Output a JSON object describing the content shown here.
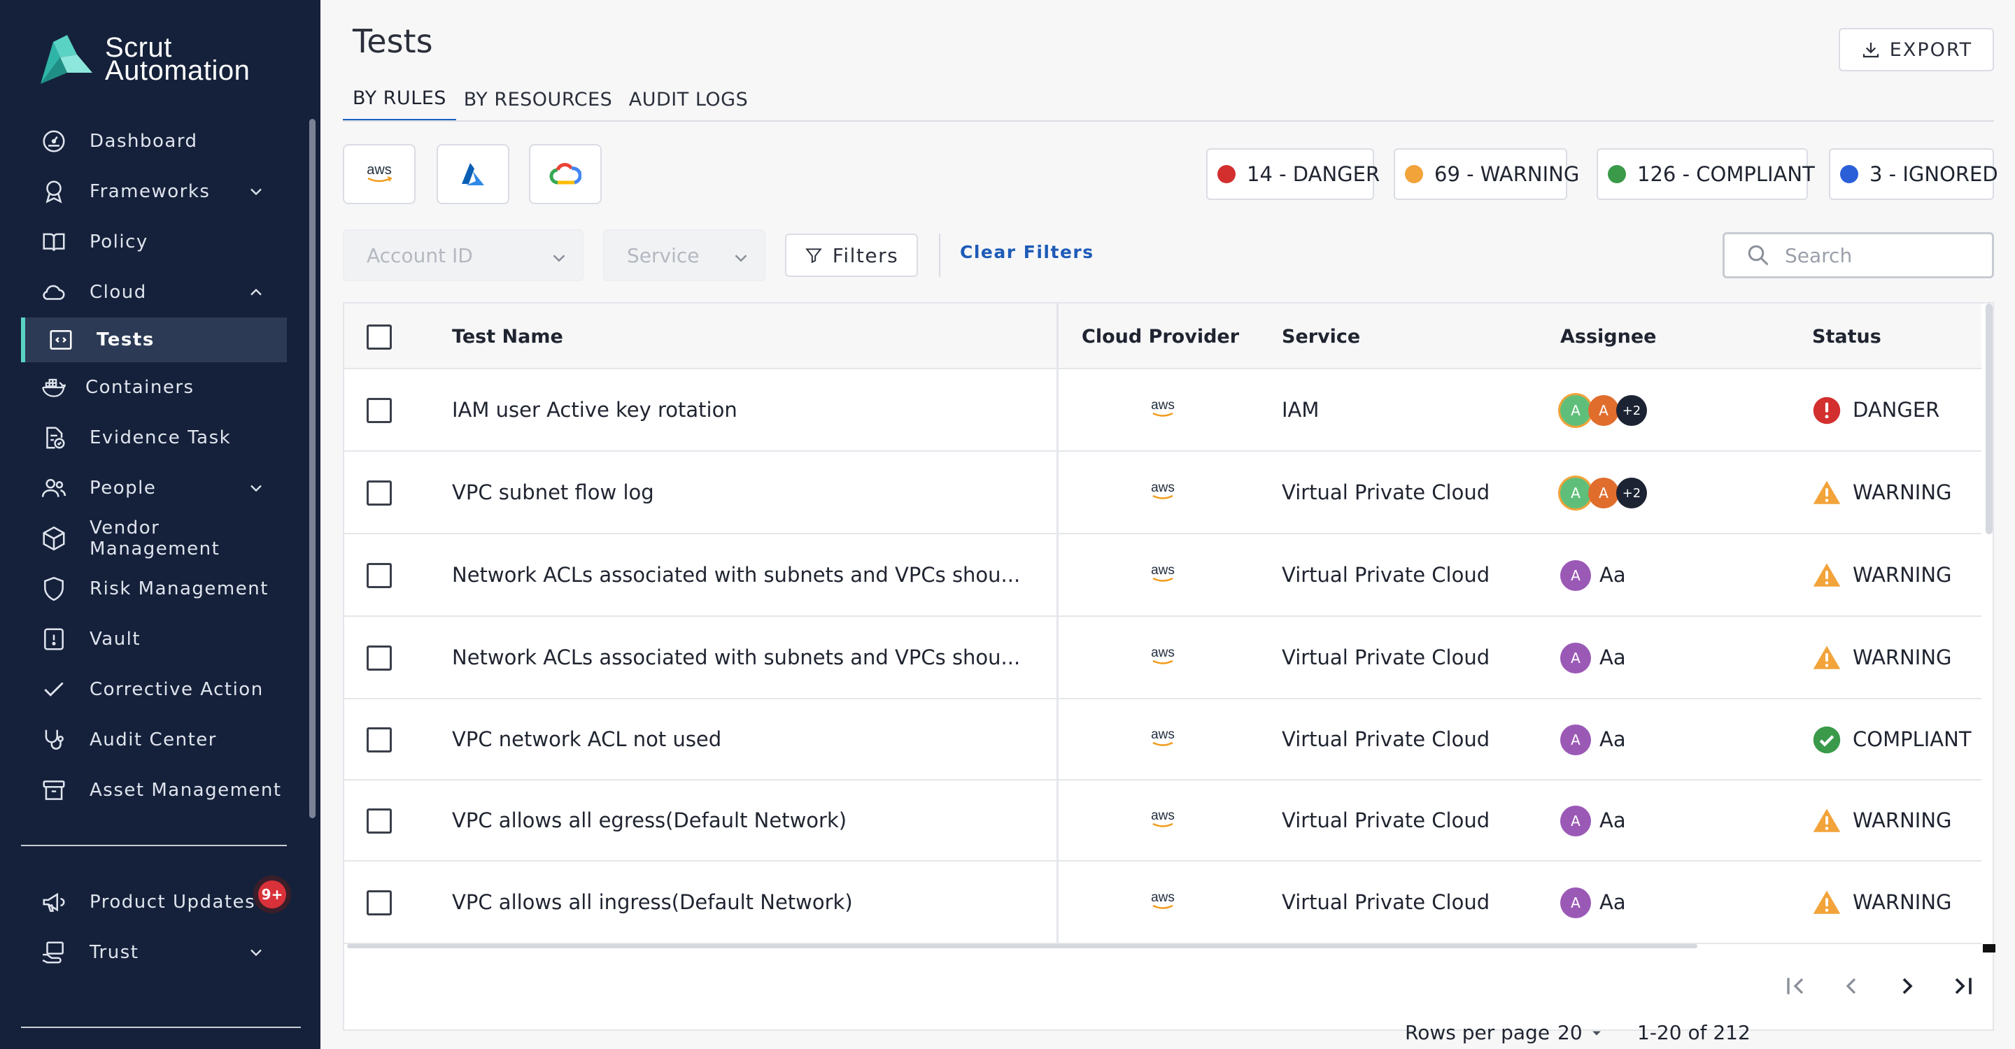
{
  "brand": {
    "line1": "Scrut",
    "line2": "Automation"
  },
  "sidebar": {
    "items": [
      {
        "label": "Dashboard",
        "icon": "dashboard-gauge-icon"
      },
      {
        "label": "Frameworks",
        "icon": "award-icon",
        "expand": "chevron-down"
      },
      {
        "label": "Policy",
        "icon": "book-icon"
      },
      {
        "label": "Cloud",
        "icon": "cloud-icon",
        "expand": "chevron-up"
      },
      {
        "label": "Tests",
        "icon": "code-window-icon",
        "active": true
      },
      {
        "label": "Containers",
        "icon": "docker-icon"
      },
      {
        "label": "Evidence Task",
        "icon": "document-check-icon"
      },
      {
        "label": "People",
        "icon": "people-icon",
        "expand": "chevron-down"
      },
      {
        "label": "Vendor Management",
        "icon": "box-icon"
      },
      {
        "label": "Risk Management",
        "icon": "shield-icon"
      },
      {
        "label": "Vault",
        "icon": "vault-icon"
      },
      {
        "label": "Corrective Action",
        "icon": "check-icon"
      },
      {
        "label": "Audit Center",
        "icon": "stethoscope-icon"
      },
      {
        "label": "Asset Management",
        "icon": "archive-icon"
      },
      {
        "label": "Product Updates",
        "icon": "megaphone-icon",
        "badge": "9+"
      },
      {
        "label": "Trust",
        "icon": "trust-hand-icon",
        "expand": "chevron-down"
      }
    ]
  },
  "header": {
    "title": "Tests",
    "tabs": [
      "BY RULES",
      "BY RESOURCES",
      "AUDIT LOGS"
    ],
    "active_tab": "BY RULES",
    "export_label": "EXPORT"
  },
  "providers": [
    {
      "name": "aws",
      "icon": "aws-logo-icon"
    },
    {
      "name": "azure",
      "icon": "azure-logo-icon"
    },
    {
      "name": "gcp",
      "icon": "google-cloud-logo-icon"
    }
  ],
  "counts": [
    {
      "label": "14 - DANGER",
      "color": "#d32f2f"
    },
    {
      "label": "69 - WARNING",
      "color": "#f2a33a"
    },
    {
      "label": "126 - COMPLIANT",
      "color": "#3a9a4a"
    },
    {
      "label": "3 - IGNORED",
      "color": "#2a5fd8"
    }
  ],
  "filters": {
    "account_placeholder": "Account ID",
    "service_placeholder": "Service",
    "filters_label": "Filters",
    "clear_label": "Clear Filters",
    "search_placeholder": "Search"
  },
  "table": {
    "columns": [
      "Test Name",
      "Cloud Provider",
      "Service",
      "Assignee",
      "Status"
    ],
    "rows": [
      {
        "name": "IAM user Active key rotation",
        "provider": "aws",
        "service": "IAM",
        "assignee": {
          "type": "group",
          "initials": [
            "A",
            "A"
          ],
          "more": "+2"
        },
        "status": "DANGER"
      },
      {
        "name": "VPC subnet flow log",
        "provider": "aws",
        "service": "Virtual Private Cloud",
        "assignee": {
          "type": "group",
          "initials": [
            "A",
            "A"
          ],
          "more": "+2"
        },
        "status": "WARNING"
      },
      {
        "name": "Network ACLs associated with subnets and VPCs shou...",
        "provider": "aws",
        "service": "Virtual Private Cloud",
        "assignee": {
          "type": "single",
          "initial": "A",
          "name": "Aa"
        },
        "status": "WARNING"
      },
      {
        "name": "Network ACLs associated with subnets and VPCs shou...",
        "provider": "aws",
        "service": "Virtual Private Cloud",
        "assignee": {
          "type": "single",
          "initial": "A",
          "name": "Aa"
        },
        "status": "WARNING"
      },
      {
        "name": "VPC network ACL not used",
        "provider": "aws",
        "service": "Virtual Private Cloud",
        "assignee": {
          "type": "single",
          "initial": "A",
          "name": "Aa"
        },
        "status": "COMPLIANT"
      },
      {
        "name": "VPC allows all egress(Default Network)",
        "provider": "aws",
        "service": "Virtual Private Cloud",
        "assignee": {
          "type": "single",
          "initial": "A",
          "name": "Aa"
        },
        "status": "WARNING"
      },
      {
        "name": "VPC allows all ingress(Default Network)",
        "provider": "aws",
        "service": "Virtual Private Cloud",
        "assignee": {
          "type": "single",
          "initial": "A",
          "name": "Aa"
        },
        "status": "WARNING"
      }
    ]
  },
  "pagination": {
    "rows_per_page_label": "Rows per page",
    "rows_per_page": "20",
    "range": "1-20 of 212"
  },
  "colors": {
    "sidebar_bg": "#15213a",
    "accent": "#5ad3c4",
    "link": "#1e5bb8",
    "danger": "#d32f2f",
    "warning": "#f2a33a",
    "compliant": "#3a9a4a",
    "ignored": "#2a5fd8"
  }
}
